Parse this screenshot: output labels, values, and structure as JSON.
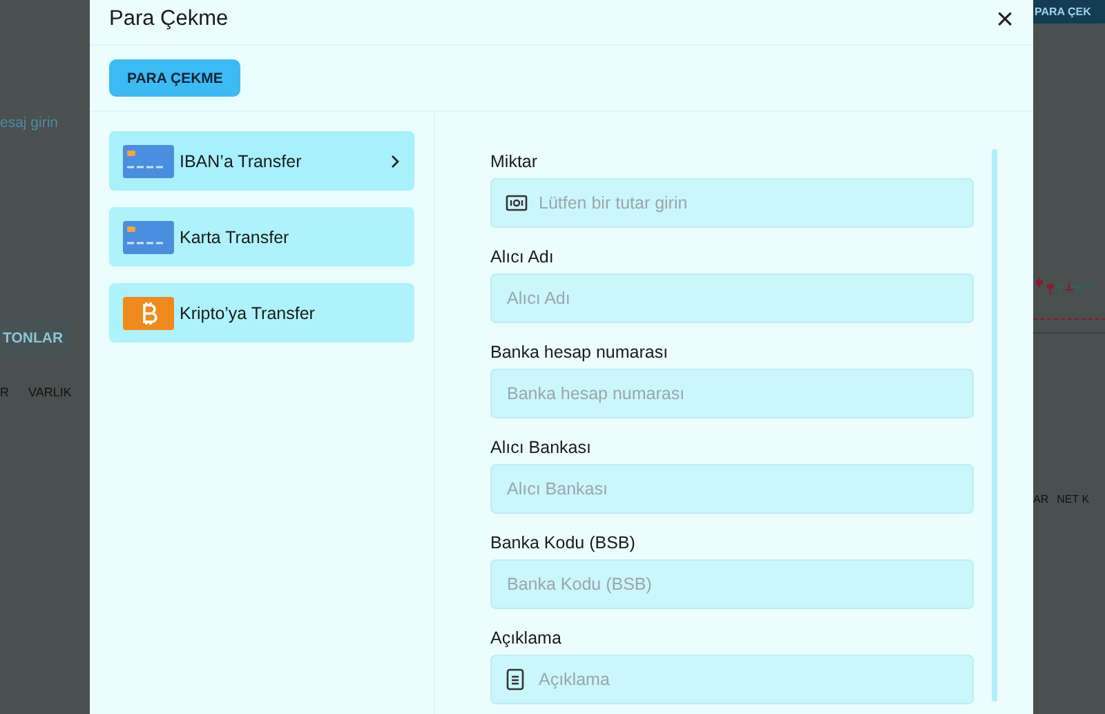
{
  "background": {
    "left": {
      "link_text": "esaj girin",
      "button": "TONLAR",
      "columns": [
        "R",
        "VARLIK"
      ]
    },
    "right": {
      "top_button": "PARA ÇEK",
      "columns": [
        "AR",
        "NET K"
      ]
    }
  },
  "dialog": {
    "title": "Para Çekme",
    "close": "×",
    "tab_button": "PARA ÇEKME",
    "methods": [
      {
        "label": "IBAN’a Transfer",
        "kind": "card",
        "selected": true
      },
      {
        "label": "Karta Transfer",
        "kind": "card",
        "selected": false
      },
      {
        "label": "Kripto’ya Transfer",
        "kind": "crypto",
        "selected": false
      }
    ],
    "fields": [
      {
        "label": "Miktar",
        "placeholder": "Lütfen bir tutar girin",
        "kind": "money"
      },
      {
        "label": "Alıcı Adı",
        "placeholder": "Alıcı Adı",
        "kind": "plain"
      },
      {
        "label": "Banka hesap numarası",
        "placeholder": "Banka hesap numarası",
        "kind": "plain"
      },
      {
        "label": "Alıcı Bankası",
        "placeholder": "Alıcı Bankası",
        "kind": "plain"
      },
      {
        "label": "Banka Kodu (BSB)",
        "placeholder": "Banka Kodu (BSB)",
        "kind": "plain"
      },
      {
        "label": "Açıklama",
        "placeholder": "Açıklama",
        "kind": "note"
      }
    ]
  }
}
